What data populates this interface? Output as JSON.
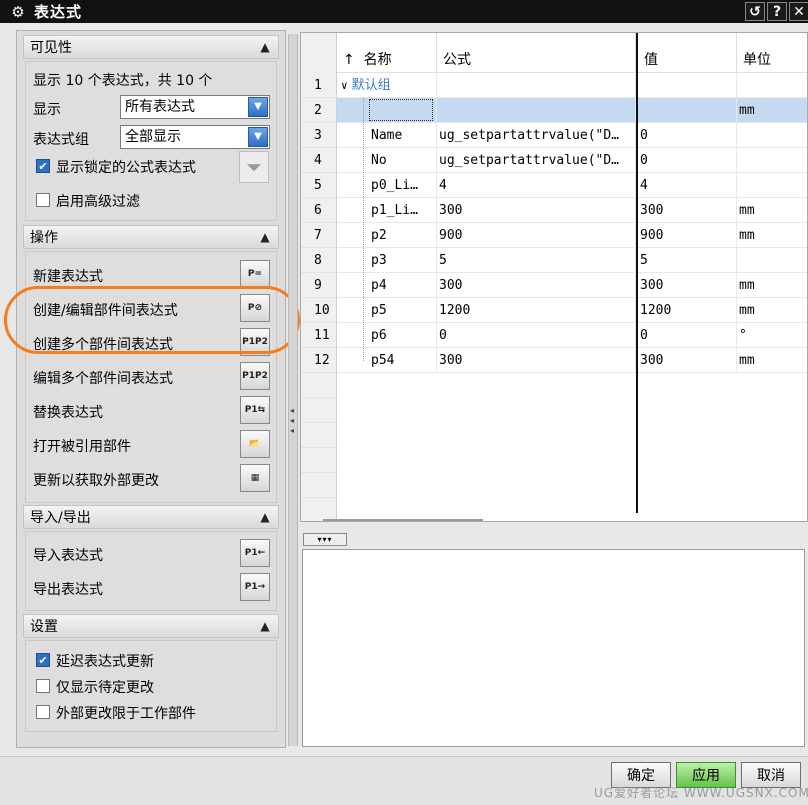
{
  "window": {
    "title": "表达式",
    "help_icon": "?",
    "restore_icon": "↺"
  },
  "visibility": {
    "header": "可见性",
    "summary": "显示 10 个表达式，共 10 个",
    "display_label": "显示",
    "display_value": "所有表达式",
    "group_label": "表达式组",
    "group_value": "全部显示",
    "show_locked": "显示锁定的公式表达式",
    "advanced_filter": "启用高级过滤"
  },
  "operations": {
    "header": "操作",
    "items": [
      {
        "label": "新建表达式",
        "icon": "new-expression-icon"
      },
      {
        "label": "创建/编辑部件间表达式",
        "icon": "edit-interpart-icon"
      },
      {
        "label": "创建多个部件间表达式",
        "icon": "create-multiple-interpart-icon"
      },
      {
        "label": "编辑多个部件间表达式",
        "icon": "edit-multiple-interpart-icon"
      },
      {
        "label": "替换表达式",
        "icon": "replace-expression-icon"
      },
      {
        "label": "打开被引用部件",
        "icon": "open-referenced-part-icon"
      },
      {
        "label": "更新以获取外部更改",
        "icon": "update-external-icon"
      }
    ]
  },
  "import_export": {
    "header": "导入/导出",
    "import_label": "导入表达式",
    "export_label": "导出表达式"
  },
  "settings": {
    "header": "设置",
    "delay_update": "延迟表达式更新",
    "pending_only": "仅显示待定更改",
    "limit_external": "外部更改限于工作部件"
  },
  "table": {
    "columns": {
      "sort": "↑",
      "name": "名称",
      "formula": "公式",
      "value": "值",
      "unit": "单位"
    },
    "group_name": "默认组",
    "rows": [
      {
        "n": "1",
        "name": "",
        "formula": "",
        "value": "",
        "unit": ""
      },
      {
        "n": "2",
        "name": "",
        "formula": "",
        "value": "",
        "unit": "mm"
      },
      {
        "n": "3",
        "name": "Name",
        "formula": "ug_setpartattrvalue(\"D…",
        "value": "0",
        "unit": ""
      },
      {
        "n": "4",
        "name": "No",
        "formula": "ug_setpartattrvalue(\"D…",
        "value": "0",
        "unit": ""
      },
      {
        "n": "5",
        "name": "p0_Li…",
        "formula": "4",
        "value": "4",
        "unit": ""
      },
      {
        "n": "6",
        "name": "p1_Li…",
        "formula": "300",
        "value": "300",
        "unit": "mm"
      },
      {
        "n": "7",
        "name": "p2",
        "formula": "900",
        "value": "900",
        "unit": "mm"
      },
      {
        "n": "8",
        "name": "p3",
        "formula": "5",
        "value": "5",
        "unit": ""
      },
      {
        "n": "9",
        "name": "p4",
        "formula": "300",
        "value": "300",
        "unit": "mm"
      },
      {
        "n": "10",
        "name": "p5",
        "formula": "1200",
        "value": "1200",
        "unit": "mm"
      },
      {
        "n": "11",
        "name": "p6",
        "formula": "0",
        "value": "0",
        "unit": "°"
      },
      {
        "n": "12",
        "name": "p54",
        "formula": "300",
        "value": "300",
        "unit": "mm"
      }
    ]
  },
  "buttons": {
    "ok": "确定",
    "apply": "应用",
    "cancel": "取消"
  },
  "watermark": "UG爱好者论坛 WWW.UGSNX.COM",
  "colors": {
    "selection": "#c5d9f1",
    "apply": "#64c24a",
    "highlight_ring": "#f47d20",
    "group_text": "#3a7bc8"
  }
}
